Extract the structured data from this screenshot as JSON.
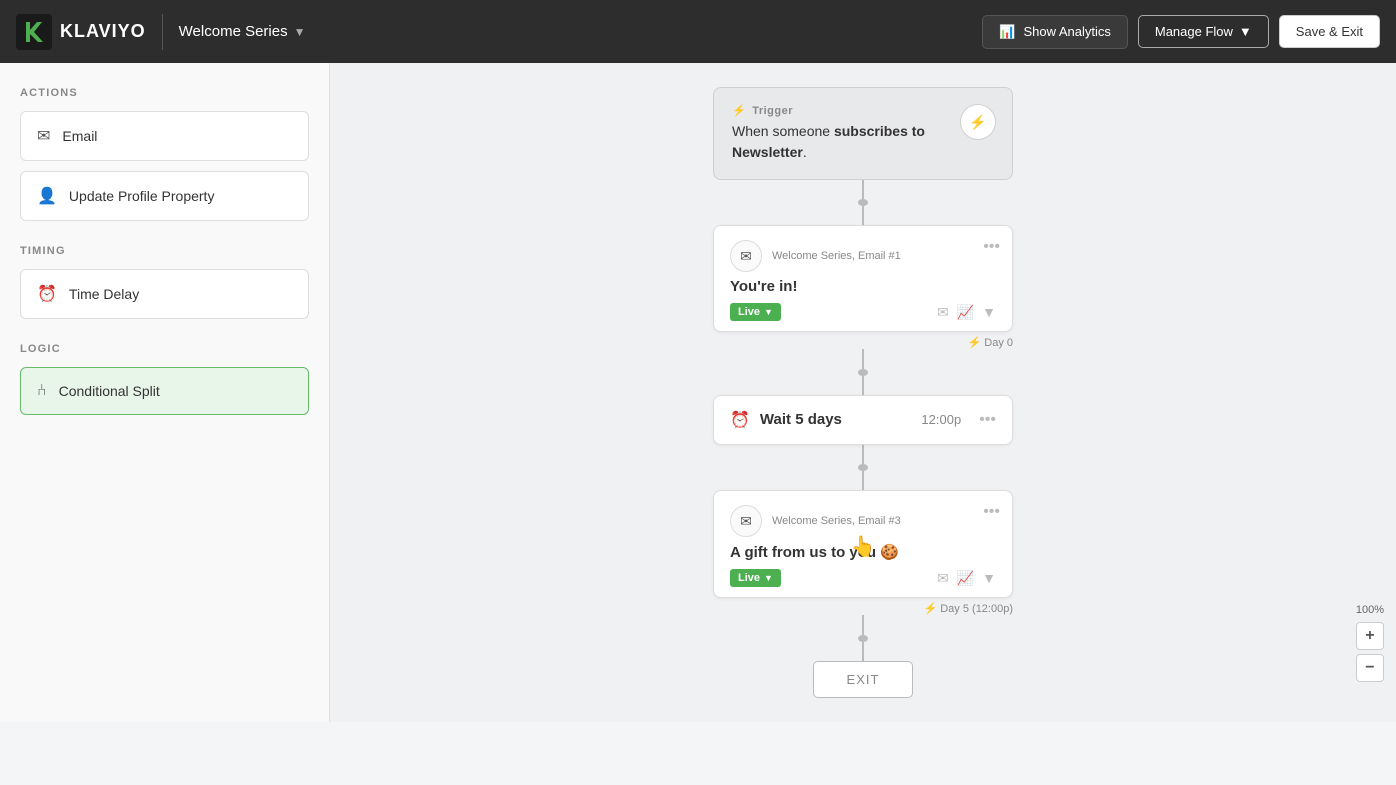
{
  "header": {
    "logo_text": "KLAVIYO",
    "flow_name": "Welcome Series",
    "show_analytics_label": "Show Analytics",
    "manage_flow_label": "Manage Flow",
    "save_exit_label": "Save & Exit"
  },
  "sidebar": {
    "actions_label": "ACTIONS",
    "timing_label": "TIMING",
    "logic_label": "LOGIC",
    "actions": [
      {
        "id": "email",
        "label": "Email",
        "icon": "✉"
      },
      {
        "id": "update-profile",
        "label": "Update Profile Property",
        "icon": "👤"
      }
    ],
    "timing": [
      {
        "id": "time-delay",
        "label": "Time Delay",
        "icon": "⏰"
      }
    ],
    "logic": [
      {
        "id": "conditional-split",
        "label": "Conditional Split",
        "icon": "⑃"
      }
    ]
  },
  "canvas": {
    "trigger": {
      "label": "Trigger",
      "text_prefix": "When someone ",
      "text_bold": "subscribes to Newsletter",
      "text_suffix": "."
    },
    "flow_nodes": [
      {
        "id": "email-1",
        "type": "email",
        "meta": "Welcome Series, Email #1",
        "title": "You're in!",
        "status": "Live",
        "day": "⚡ Day 0"
      },
      {
        "id": "wait-1",
        "type": "wait",
        "title": "Wait 5 days",
        "time": "12:00p"
      },
      {
        "id": "email-3",
        "type": "email",
        "meta": "Welcome Series, Email #3",
        "title": "A gift from us to you 🍪",
        "status": "Live",
        "day": "⚡ Day 5 (12:00p)"
      }
    ],
    "exit_label": "EXIT"
  },
  "zoom": {
    "level": "100%",
    "plus": "+",
    "minus": "−"
  }
}
